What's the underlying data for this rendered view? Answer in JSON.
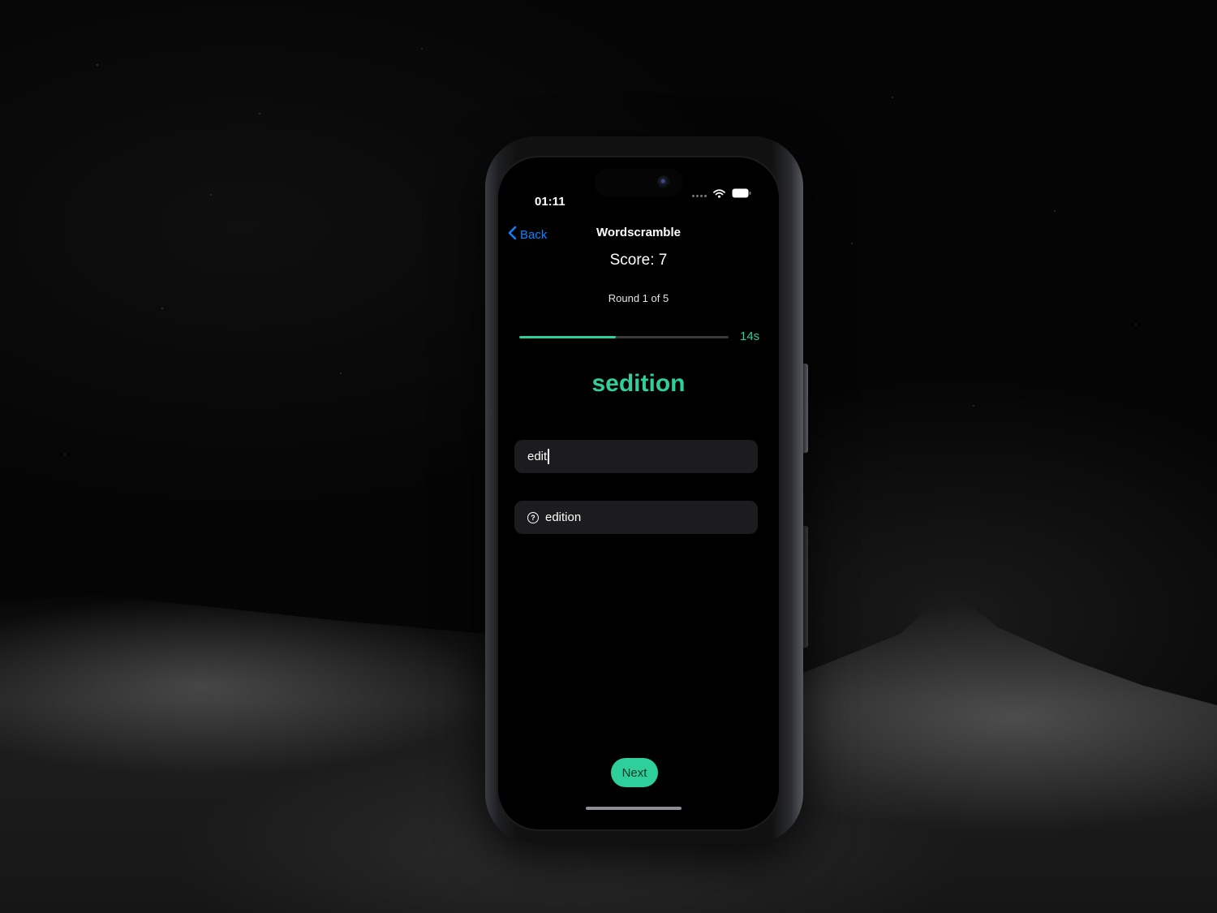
{
  "status_bar": {
    "time": "01:11"
  },
  "nav": {
    "back_label": "Back",
    "title": "Wordscramble"
  },
  "game": {
    "score_text": "Score: 7",
    "round_text": "Round 1 of 5",
    "timer_text": "14s",
    "timer_progress": 0.46,
    "scrambled_word": "sedition",
    "input_value": "edit",
    "guesses": [
      {
        "icon": "question-circle-icon",
        "word": "edition"
      }
    ],
    "next_label": "Next"
  },
  "colors": {
    "accent": "#2ecf9a",
    "link": "#0a84ff",
    "field_bg": "#1c1c1e",
    "background": "#000000"
  }
}
